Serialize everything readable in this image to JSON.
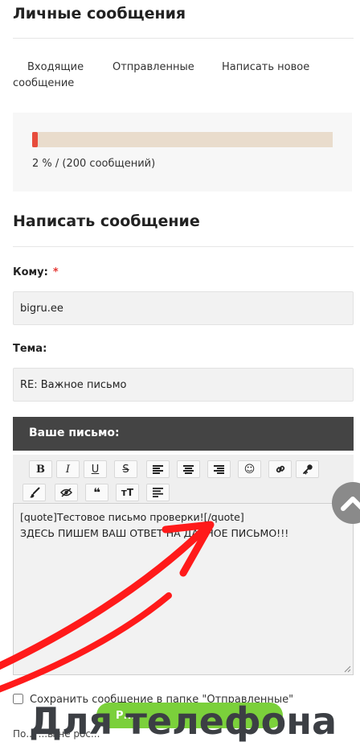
{
  "header": {
    "title": "Личные сообщения"
  },
  "tabs": [
    {
      "label": "Входящие сообщение"
    },
    {
      "label": "Отправленные"
    },
    {
      "label": "Написать новое"
    }
  ],
  "quota": {
    "percent": 2,
    "text": "2 % / (200 сообщений)",
    "bar_color": "#e74c3c",
    "track_color": "#e9dccc"
  },
  "compose": {
    "title": "Написать сообщение",
    "to_label": "Кому:",
    "required_mark": "*",
    "to_value": "bigru.ee",
    "subject_label": "Тема:",
    "subject_value": "RE: Важное письмо",
    "letter_label": "Ваше письмо:",
    "toolbar": [
      {
        "name": "bold",
        "glyph": "B"
      },
      {
        "name": "italic",
        "glyph": "I"
      },
      {
        "name": "underline",
        "glyph": "U"
      },
      {
        "name": "strikethrough",
        "glyph": "S"
      },
      {
        "name": "align-left",
        "glyph": "≡"
      },
      {
        "name": "align-center",
        "glyph": "≡"
      },
      {
        "name": "align-right",
        "glyph": "≡"
      },
      {
        "name": "smiley",
        "glyph": "☺"
      },
      {
        "name": "link",
        "glyph": "🔗"
      },
      {
        "name": "key",
        "glyph": "🔑"
      },
      {
        "name": "brush",
        "glyph": "🖌"
      },
      {
        "name": "hide",
        "glyph": "👁"
      },
      {
        "name": "quote",
        "glyph": "❝"
      },
      {
        "name": "font-size",
        "glyph": "тТ"
      },
      {
        "name": "paragraph",
        "glyph": "≣"
      }
    ],
    "body_line1": "[quote]Тестовое письмо проверки![/quote]",
    "body_line2": "ЗДЕСЬ ПИШЕМ ВАШ ОТВЕТ НА ДАННОЕ ПИСЬМО!!!",
    "save_label": "Сохранить сообщение в папке \"Отправленные\"",
    "send_label": "Р...",
    "footer_note": "По... ...ы не рос..."
  },
  "overlay": {
    "watermark": "Для телефона",
    "arrow_color": "#ff1a1a"
  },
  "colors": {
    "accent_green": "#7bd03b",
    "dark_header": "#444444"
  }
}
